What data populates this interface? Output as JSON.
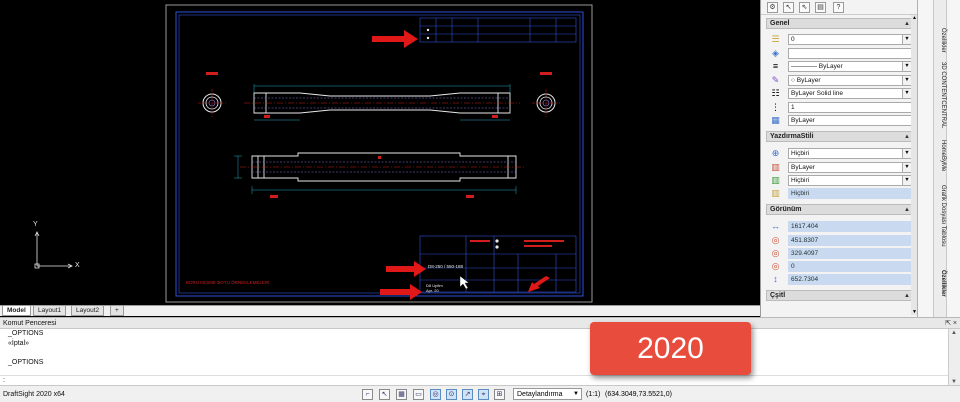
{
  "app": {
    "name": "DraftSight 2020 x64"
  },
  "canvas": {
    "ucs_y": "Y",
    "ucs_x": "X",
    "drawing_note": "BORU KESME BOYU ÖRNEKLEMELERİ",
    "title_block_lines": [
      "D8-250 / 550-188",
      "D8 Upfim",
      "Apr. 20"
    ],
    "colors": {
      "frame": "#2f4fd8",
      "geometry": "#e8e8e8",
      "centerline": "#d21d1d",
      "dimension": "#2aa8c8",
      "hidden": "#7a7adf",
      "arrow": "#e01818"
    }
  },
  "layout_tabs": [
    "Model",
    "Layout1",
    "Layout2",
    "+"
  ],
  "command_window": {
    "title": "Komut Penceresi",
    "controls": "⇱ ×",
    "lines": [
      "_OPTIONS",
      "«İptal»",
      "",
      "_OPTIONS"
    ],
    "prompt": ":"
  },
  "properties": {
    "toolbar_icons": [
      "quick-select-icon",
      "select-objects-icon",
      "toggle-pickadd-icon",
      "help-icon"
    ],
    "sections": {
      "general": {
        "title": "Genel",
        "rows": [
          {
            "icon": "layer-icon",
            "value": "0"
          },
          {
            "icon": "color-icon",
            "value": ""
          },
          {
            "icon": "linetype-icon",
            "value": "———— ByLayer"
          },
          {
            "icon": "lineweight-icon",
            "value": "○ ByLayer"
          },
          {
            "icon": "linescale-icon",
            "value": "ByLayer       Solid line"
          },
          {
            "icon": "transparency-icon",
            "value": "1"
          },
          {
            "icon": "thickness-icon",
            "value": "ByLayer"
          }
        ]
      },
      "print_style": {
        "title": "YazdırmaStili",
        "rows": [
          {
            "icon": "print-style-icon",
            "value": "Hiçbiri"
          },
          {
            "icon": "print-table-icon",
            "value": "ByLayer"
          },
          {
            "icon": "print-attached-icon",
            "value": "Hiçbiri"
          },
          {
            "icon": "print-type-icon",
            "value": "Hiçbiri"
          }
        ]
      },
      "view": {
        "title": "Görünüm",
        "rows": [
          {
            "icon": "width-icon",
            "value": "1617.404"
          },
          {
            "icon": "center-x-icon",
            "value": "451.8307"
          },
          {
            "icon": "center-y-icon",
            "value": "329.4097"
          },
          {
            "icon": "center-z-icon",
            "value": "0"
          },
          {
            "icon": "height-icon",
            "value": "652.7304"
          }
        ]
      },
      "misc": {
        "title": "Çşitl"
      }
    },
    "section_toggle": "▲",
    "select_arrow": "▼"
  },
  "vertical_tabs": [
    "Özellikler",
    "3D CONTENTCENTRAL",
    "HomeByMe",
    "Grafik Dosyası Tablosu",
    "Özellikler"
  ],
  "status_bar": {
    "annotation_dropdown": "Detaylandırma",
    "scale": "(1:1)",
    "coordinates": "(634.3049,73.5521,0)"
  },
  "overlay": {
    "year": "2020"
  }
}
